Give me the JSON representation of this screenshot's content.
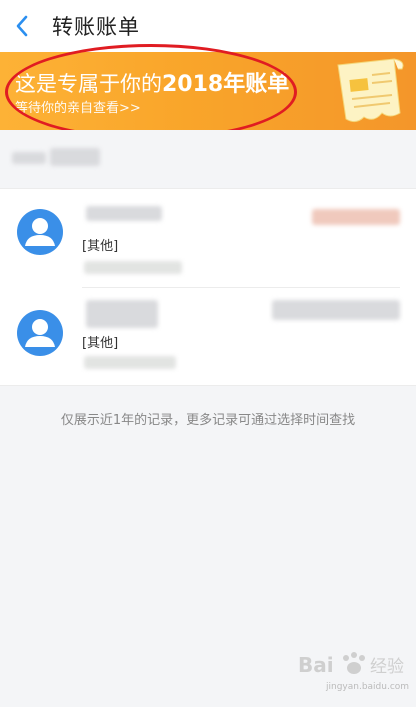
{
  "header": {
    "title": "转账账单"
  },
  "banner": {
    "title_prefix": "这是专属于你的",
    "title_bold": "2018年账单",
    "subtitle": "等待你的亲自查看>>"
  },
  "transfers": [
    {
      "category": "[其他]"
    },
    {
      "category": "[其他]"
    }
  ],
  "footer": {
    "note": "仅展示近1年的记录，更多记录可通过选择时间查找"
  },
  "watermark": {
    "brand": "Bai 经验",
    "url": "jingyan.baidu.com"
  },
  "colors": {
    "accent_blue": "#3a8fe8",
    "banner_orange": "#f9a52a",
    "annotation_red": "#e01c22"
  }
}
